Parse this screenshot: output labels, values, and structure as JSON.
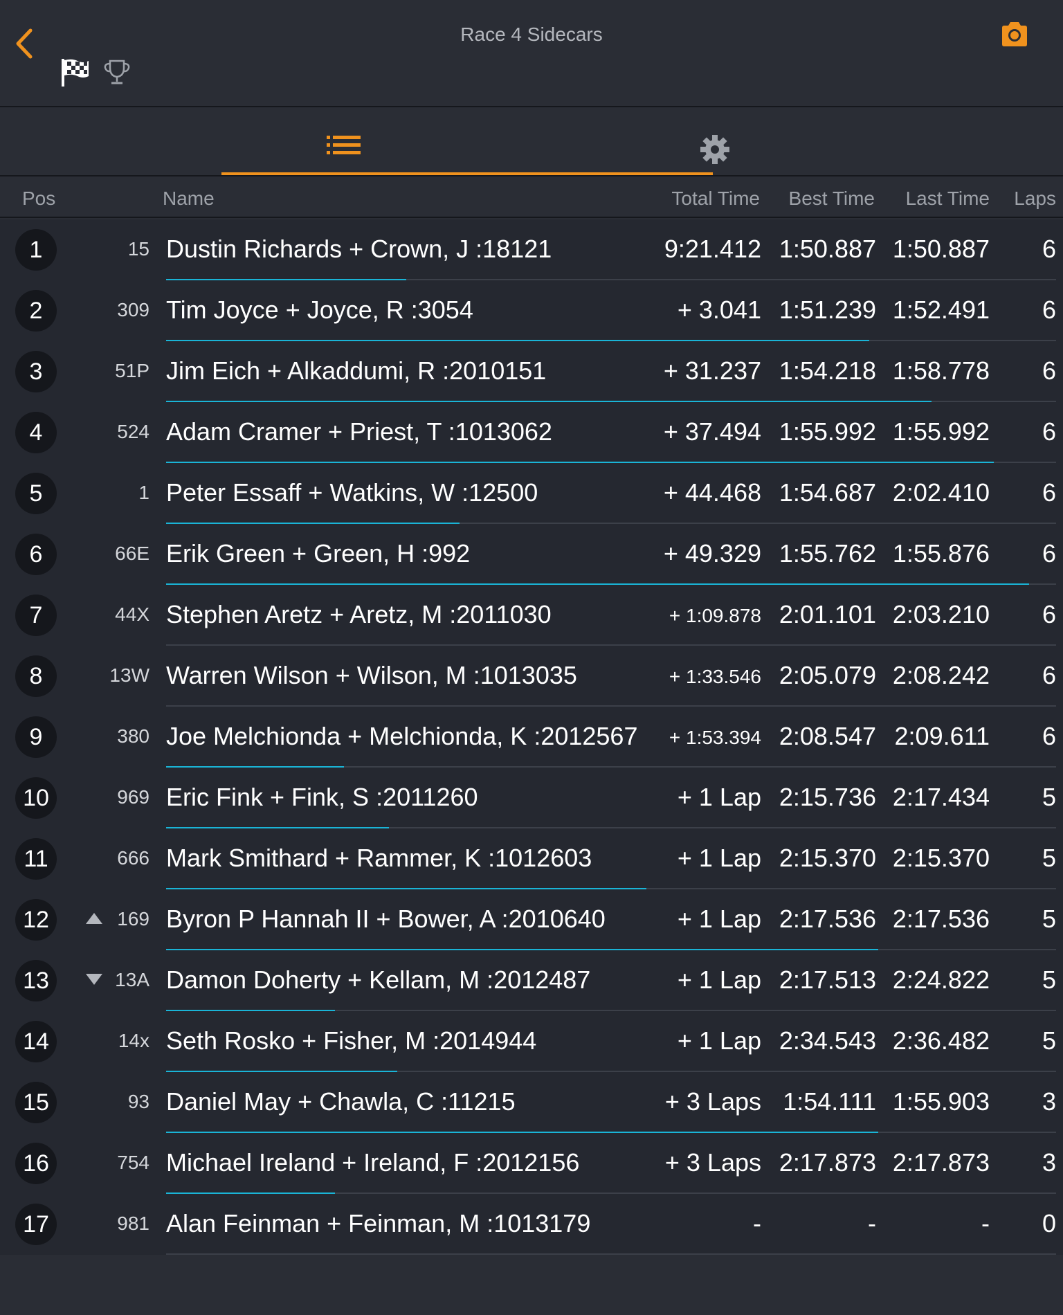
{
  "header": {
    "title": "Race 4 Sidecars"
  },
  "columns": {
    "pos": "Pos",
    "name": "Name",
    "total": "Total Time",
    "best": "Best Time",
    "last": "Last Time",
    "laps": "Laps"
  },
  "colors": {
    "accent": "#f0921e",
    "progress": "#1ab4d6",
    "background": "#2a2d35"
  },
  "rows": [
    {
      "pos": "1",
      "num": "15",
      "name": "Dustin Richards + Crown, J :18121",
      "total": "9:21.412",
      "best": "1:50.887",
      "last": "1:50.887",
      "laps": "6",
      "trend": "",
      "progress": 0.27
    },
    {
      "pos": "2",
      "num": "309",
      "name": "Tim Joyce + Joyce, R :3054",
      "total": "+ 3.041",
      "best": "1:51.239",
      "last": "1:52.491",
      "laps": "6",
      "trend": "",
      "progress": 0.79
    },
    {
      "pos": "3",
      "num": "51P",
      "name": "Jim Eich + Alkaddumi, R :2010151",
      "total": "+ 31.237",
      "best": "1:54.218",
      "last": "1:58.778",
      "laps": "6",
      "trend": "",
      "progress": 0.86
    },
    {
      "pos": "4",
      "num": "524",
      "name": "Adam Cramer + Priest, T :1013062",
      "total": "+ 37.494",
      "best": "1:55.992",
      "last": "1:55.992",
      "laps": "6",
      "trend": "",
      "progress": 0.93
    },
    {
      "pos": "5",
      "num": "1",
      "name": "Peter Essaff + Watkins, W :12500",
      "total": "+ 44.468",
      "best": "1:54.687",
      "last": "2:02.410",
      "laps": "6",
      "trend": "",
      "progress": 0.33
    },
    {
      "pos": "6",
      "num": "66E",
      "name": "Erik Green + Green, H :992",
      "total": "+ 49.329",
      "best": "1:55.762",
      "last": "1:55.876",
      "laps": "6",
      "trend": "",
      "progress": 0.97
    },
    {
      "pos": "7",
      "num": "44X",
      "name": "Stephen Aretz + Aretz, M :2011030",
      "total": "+ 1:09.878",
      "best": "2:01.101",
      "last": "2:03.210",
      "laps": "6",
      "trend": "",
      "progress": 0.0
    },
    {
      "pos": "8",
      "num": "13W",
      "name": "Warren Wilson + Wilson, M :1013035",
      "total": "+ 1:33.546",
      "best": "2:05.079",
      "last": "2:08.242",
      "laps": "6",
      "trend": "",
      "progress": 0.0
    },
    {
      "pos": "9",
      "num": "380",
      "name": "Joe Melchionda + Melchionda, K :2012567",
      "total": "+ 1:53.394",
      "best": "2:08.547",
      "last": "2:09.611",
      "laps": "6",
      "trend": "",
      "progress": 0.2
    },
    {
      "pos": "10",
      "num": "969",
      "name": "Eric Fink + Fink, S :2011260",
      "total": "+ 1 Lap",
      "best": "2:15.736",
      "last": "2:17.434",
      "laps": "5",
      "trend": "",
      "progress": 0.25
    },
    {
      "pos": "11",
      "num": "666",
      "name": "Mark Smithard + Rammer, K :1012603",
      "total": "+ 1 Lap",
      "best": "2:15.370",
      "last": "2:15.370",
      "laps": "5",
      "trend": "",
      "progress": 0.54
    },
    {
      "pos": "12",
      "num": "169",
      "name": "Byron P Hannah II + Bower, A :2010640",
      "total": "+ 1 Lap",
      "best": "2:17.536",
      "last": "2:17.536",
      "laps": "5",
      "trend": "up",
      "progress": 0.8
    },
    {
      "pos": "13",
      "num": "13A",
      "name": "Damon Doherty + Kellam, M :2012487",
      "total": "+ 1 Lap",
      "best": "2:17.513",
      "last": "2:24.822",
      "laps": "5",
      "trend": "down",
      "progress": 0.19
    },
    {
      "pos": "14",
      "num": "14x",
      "name": "Seth Rosko + Fisher, M :2014944",
      "total": "+ 1 Lap",
      "best": "2:34.543",
      "last": "2:36.482",
      "laps": "5",
      "trend": "",
      "progress": 0.26
    },
    {
      "pos": "15",
      "num": "93",
      "name": "Daniel May + Chawla, C :11215",
      "total": "+ 3 Laps",
      "best": "1:54.111",
      "last": "1:55.903",
      "laps": "3",
      "trend": "",
      "progress": 0.8
    },
    {
      "pos": "16",
      "num": "754",
      "name": "Michael Ireland + Ireland, F :2012156",
      "total": "+ 3 Laps",
      "best": "2:17.873",
      "last": "2:17.873",
      "laps": "3",
      "trend": "",
      "progress": 0.19
    },
    {
      "pos": "17",
      "num": "981",
      "name": "Alan Feinman + Feinman, M :1013179",
      "total": "-",
      "best": "-",
      "last": "-",
      "laps": "0",
      "trend": "",
      "progress": 0.0
    }
  ]
}
